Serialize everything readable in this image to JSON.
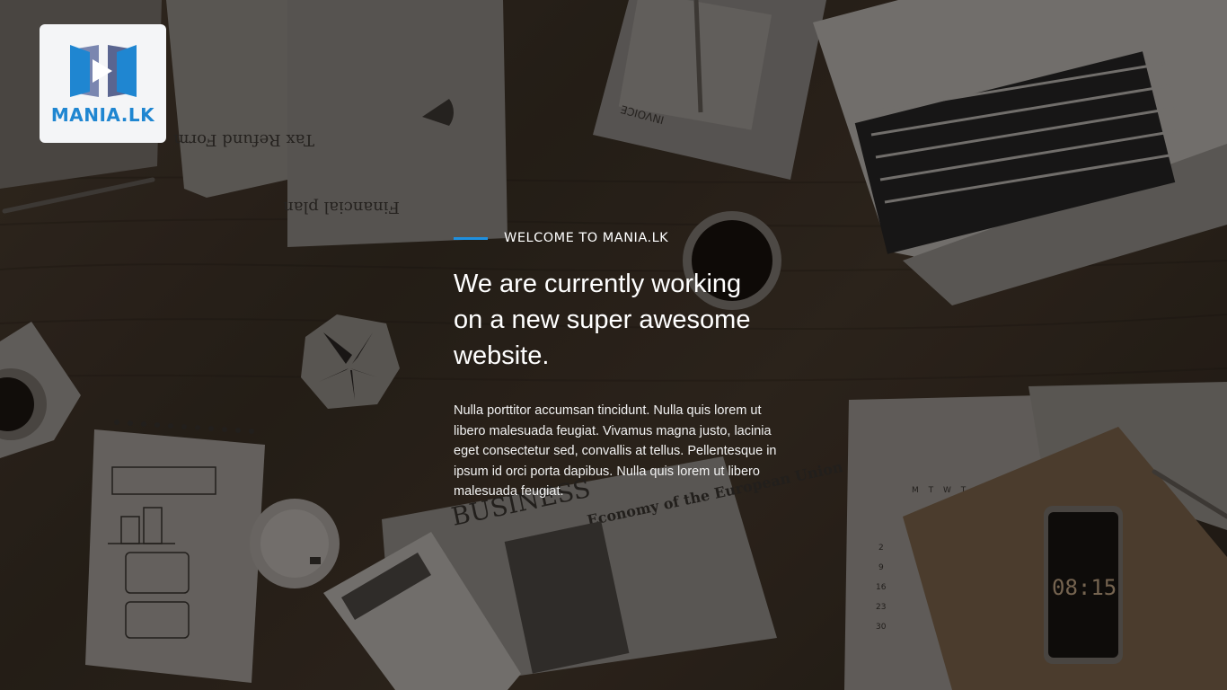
{
  "logo": {
    "text": "MANIA.LK",
    "icon": "play-icon",
    "brand_color": "#1f86d1"
  },
  "hero": {
    "eyebrow": "WELCOME TO MANIA.LK",
    "headline": "We are currently working on a new super awesome website.",
    "description": "Nulla porttitor accumsan tincidunt. Nulla quis lorem ut libero malesuada feugiat. Vivamus magna justo, lacinia eget consectetur sed, convallis at tellus. Pellentesque in ipsum id orci porta dapibus. Nulla quis lorem ut libero malesuada feugiat.",
    "accent_color": "#1e90e0"
  },
  "background": {
    "papers": {
      "tax_form": "Tax Refund Form",
      "financial_plan": "Financial plan",
      "invoice": "INVOICE",
      "newspaper_masthead": "BUSINESS",
      "newspaper_headline": "Economy of the European Union",
      "phone_clock": "08:15",
      "calendar_header": "M T W T",
      "calendar_days": [
        "2",
        "9",
        "16",
        "23",
        "30"
      ]
    }
  }
}
